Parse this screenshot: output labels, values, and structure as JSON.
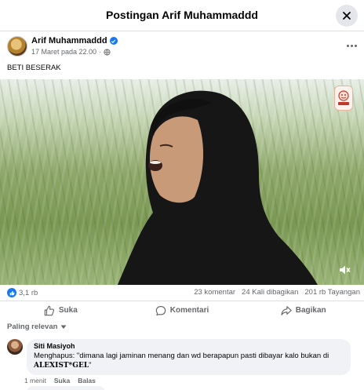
{
  "header": {
    "title": "Postingan Arif Muhammaddd"
  },
  "post": {
    "author": "Arif Muhammaddd",
    "meta": "17 Maret pada 22.00",
    "meta_separator": "·",
    "text": "BETI BESERAK"
  },
  "stats": {
    "reactions": "3,1 rb",
    "comments": "23 komentar",
    "shares": "24 Kali dibagikan",
    "views": "201 rb Tayangan"
  },
  "actions": {
    "like": "Suka",
    "comment": "Komentari",
    "share": "Bagikan"
  },
  "sort": {
    "label": "Paling relevan"
  },
  "comment": {
    "name": "Siti Masiyoh",
    "text_before": "Menghapus: \"dimana lagi jaminan menang dan wd berapapun pasti dibayar kalo bukan di ",
    "text_bold": "ALEXIST*GEL",
    "text_after": "\"",
    "time": "1 menit",
    "like": "Suka",
    "reply": "Balas"
  },
  "colors": {
    "accent": "#1877f2",
    "secondary_text": "#65676b",
    "bubble": "#f0f2f5"
  },
  "icons": {
    "close": "close-icon",
    "verified": "verified-badge-icon",
    "globe": "globe-icon",
    "more": "more-icon",
    "mute": "mute-icon",
    "like": "thumbs-up-icon",
    "comment": "comment-icon",
    "share": "share-icon",
    "chevron": "chevron-down-icon"
  }
}
